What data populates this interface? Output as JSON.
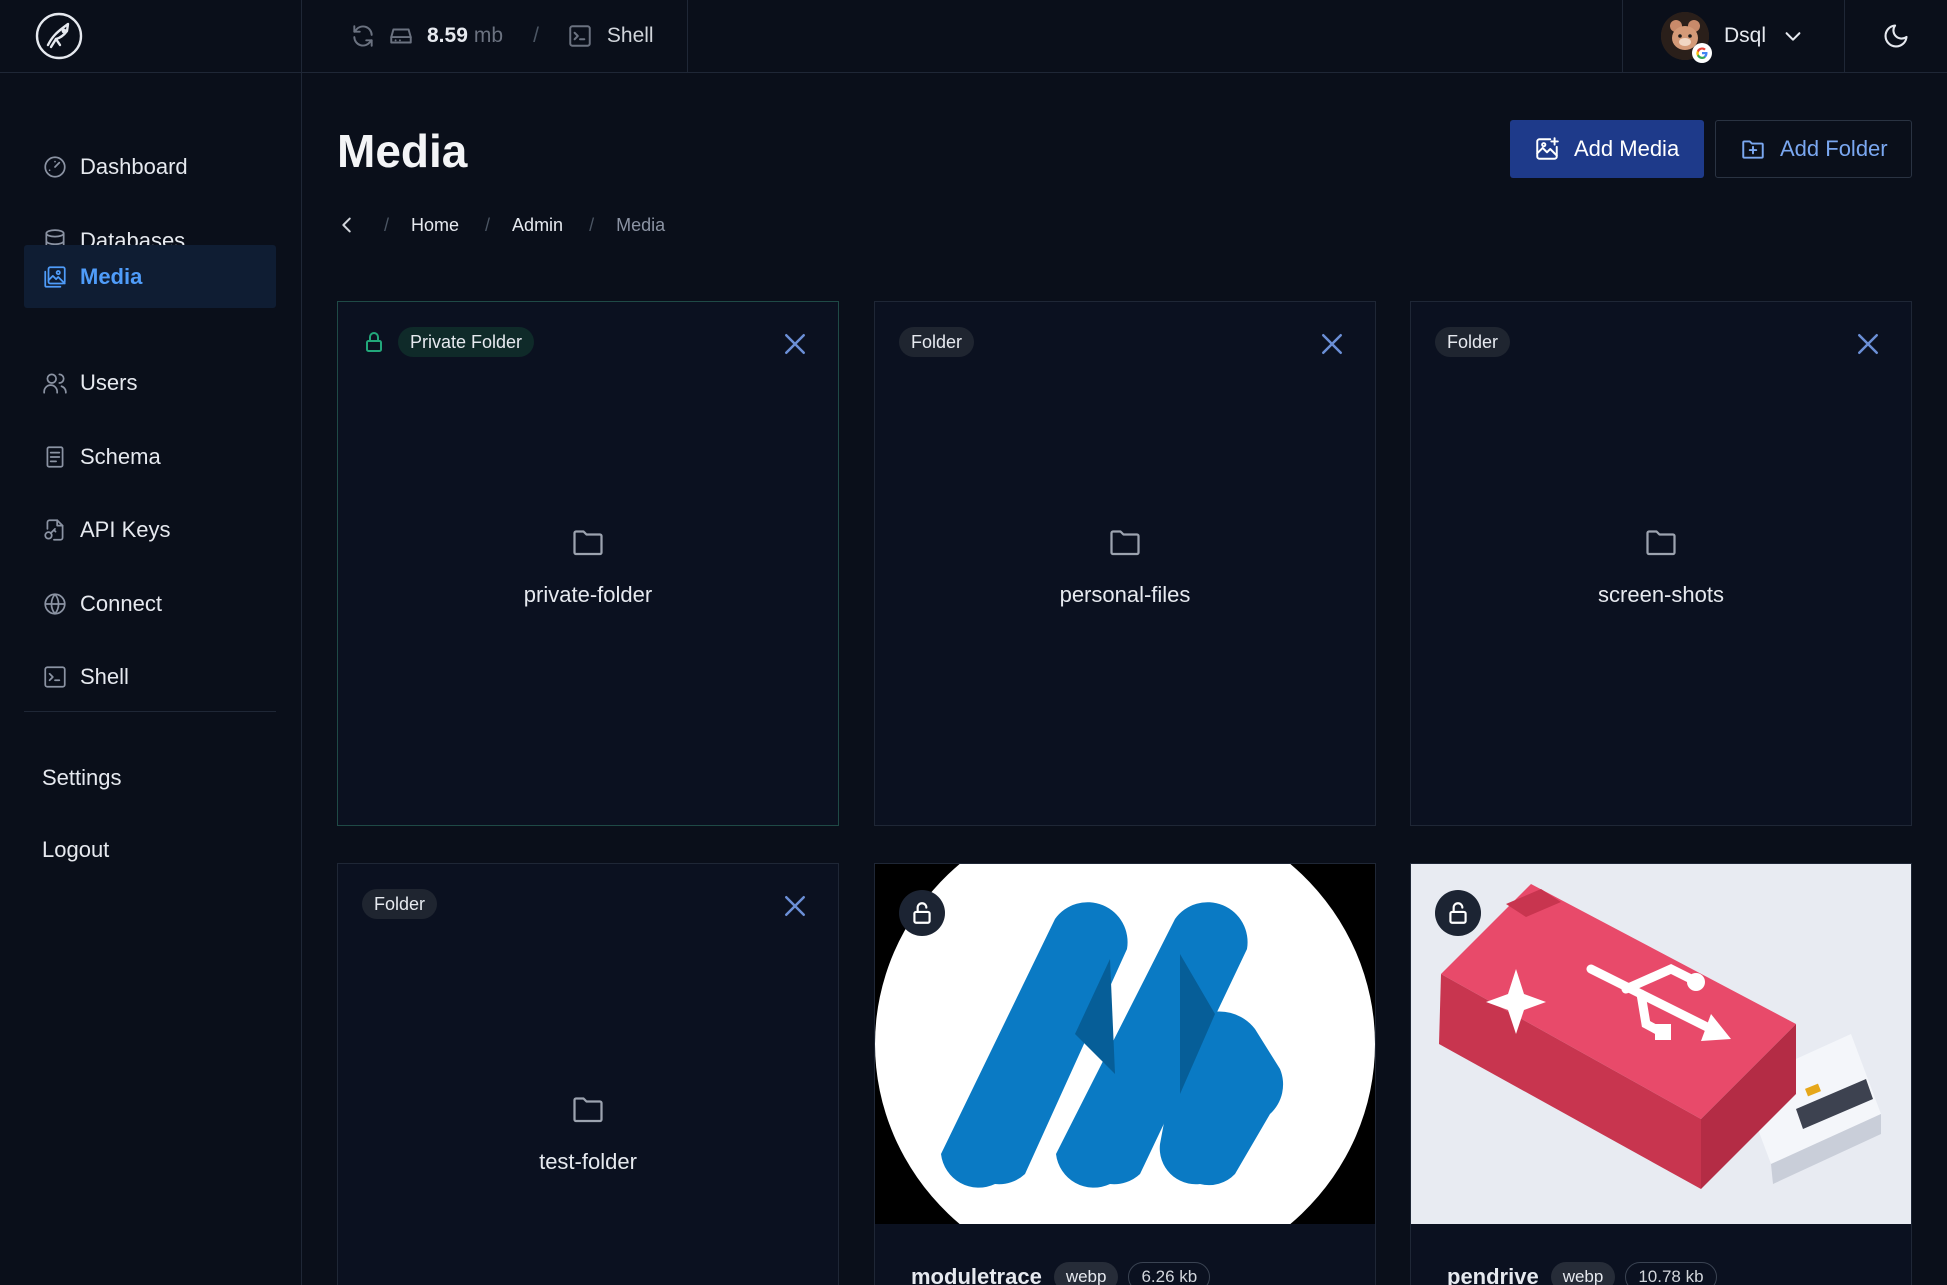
{
  "topbar": {
    "storage_used": "8.59",
    "storage_unit": "mb",
    "separator": "/",
    "shell_label": "Shell",
    "user_name": "Dsql"
  },
  "sidebar": {
    "items": [
      {
        "label": "Dashboard",
        "icon": "dashboard-icon"
      },
      {
        "label": "Databases",
        "icon": "database-icon"
      },
      {
        "label": "Media",
        "icon": "media-icon",
        "active": true
      },
      {
        "label": "Users",
        "icon": "users-icon"
      },
      {
        "label": "Schema",
        "icon": "schema-icon"
      },
      {
        "label": "API Keys",
        "icon": "api-keys-icon"
      },
      {
        "label": "Connect",
        "icon": "globe-icon"
      },
      {
        "label": "Shell",
        "icon": "shell-icon"
      }
    ],
    "settings_label": "Settings",
    "logout_label": "Logout"
  },
  "main": {
    "title": "Media",
    "add_media_label": "Add Media",
    "add_folder_label": "Add Folder",
    "breadcrumb": {
      "separator": "/",
      "items": [
        "Home",
        "Admin",
        "Media"
      ]
    }
  },
  "folders": [
    {
      "badge": "Private Folder",
      "name": "private-folder",
      "private": true
    },
    {
      "badge": "Folder",
      "name": "personal-files"
    },
    {
      "badge": "Folder",
      "name": "screen-shots"
    },
    {
      "badge": "Folder",
      "name": "test-folder"
    }
  ],
  "media": [
    {
      "name": "moduletrace",
      "type": "webp",
      "size": "6.26 kb"
    },
    {
      "name": "pendrive",
      "type": "webp",
      "size": "10.78 kb"
    }
  ],
  "colors": {
    "background": "#0a0f1a",
    "accent": "#4f9cf9",
    "primary_button": "#1e3a8a",
    "private_lock": "#22a77a"
  }
}
